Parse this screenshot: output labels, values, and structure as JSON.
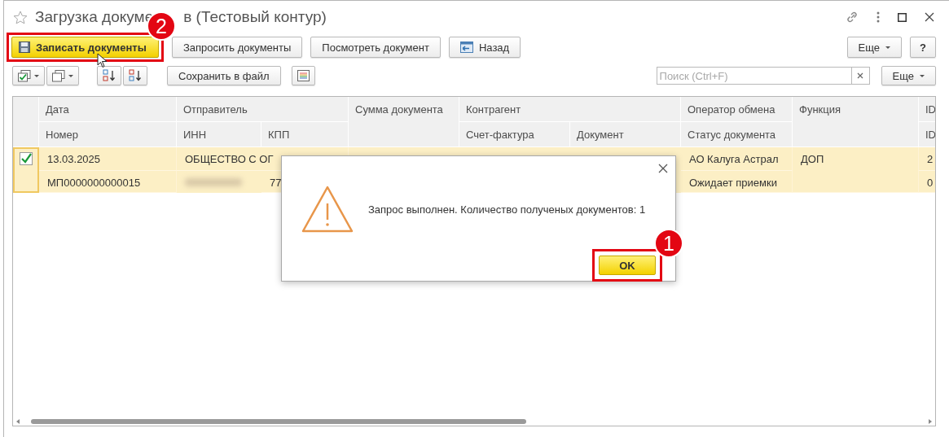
{
  "window": {
    "title": "Загрузка докуме",
    "title_2": "в (Тестовый контур)"
  },
  "toolbar": {
    "buttons": [
      {
        "label": "Записать документы",
        "kind": "primary"
      },
      {
        "label": "Запросить документы",
        "kind": "default"
      },
      {
        "label": "Посмотреть документ",
        "kind": "default"
      },
      {
        "label": "Назад",
        "kind": "back"
      }
    ],
    "more": "Еще",
    "help": "?"
  },
  "toolbar2": {
    "save_to_file": "Сохранить в файл",
    "search": {
      "placeholder": "Поиск (Ctrl+F)"
    },
    "more": "Еще"
  },
  "table": {
    "header": [
      "Дата",
      "Номер",
      "Отправитель",
      "ИНН",
      "КПП",
      "Сумма документа",
      "Контрагент",
      "Счет-фактура",
      "Документ",
      "Оператор обмена",
      "Статус документа",
      "Функция",
      "ID",
      "ID"
    ],
    "rows": [
      {
        "checked": true,
        "selected": true,
        "date": "13.03.2025",
        "number": "МП0000000000015",
        "sender": "ОБЩЕСТВО С ОГ",
        "kpp": "77",
        "operator": "АО Калуга Астрал",
        "status": "Ожидает приемки",
        "function": "ДОП",
        "id": "2",
        "id_2": "0"
      }
    ]
  },
  "dialog": {
    "message": "Запрос выполнен. Количество полученых документов: 1",
    "ok": "OK"
  },
  "callouts": [
    {
      "number": "2"
    },
    {
      "number": "1"
    }
  ]
}
